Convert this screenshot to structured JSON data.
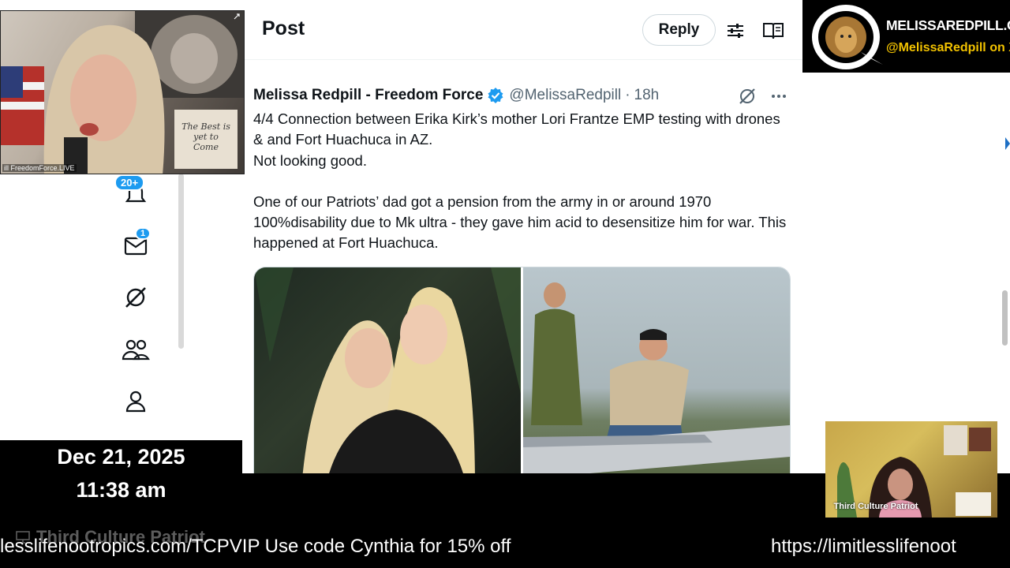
{
  "header": {
    "title": "Post",
    "reply_label": "Reply"
  },
  "sidebar": {
    "notifications_badge": "20+",
    "messages_badge": "1"
  },
  "tweet": {
    "author_name": "Melissa Redpill - Freedom Force",
    "handle": "@MelissaRedpill",
    "dot": "·",
    "time": "18h",
    "lines": [
      "4/4 Connection between Erika Kirk’s mother Lori Frantze EMP testing with drones & and Fort Huachuca in AZ.",
      "Not looking good.",
      "",
      "One of our Patriots’ dad got a pension from the army in or around 1970 100%disability due to Mk ultra - they gave him acid to desensitize him for war. This happened at Fort Huachuca."
    ]
  },
  "overlay": {
    "cam_label": "ill FreedomForce.LIVE",
    "cam_sign": "The Best is yet to Come",
    "brand_url": "MELISSAREDPILL.COM",
    "brand_handle": "@MelissaRedpill on X",
    "small_cam_label": "Third Culture Patriot",
    "date": "Dec 21, 2025",
    "time": "11:38 am",
    "channel": "Third Culture Patriot",
    "ticker_left": "lesslifenootropics.com/TCPVIP  Use code Cynthia for 15% off",
    "ticker_right": "https://limitlesslifenoot"
  },
  "colors": {
    "accent": "#1d9bf0",
    "brand_handle": "#f2c200"
  }
}
